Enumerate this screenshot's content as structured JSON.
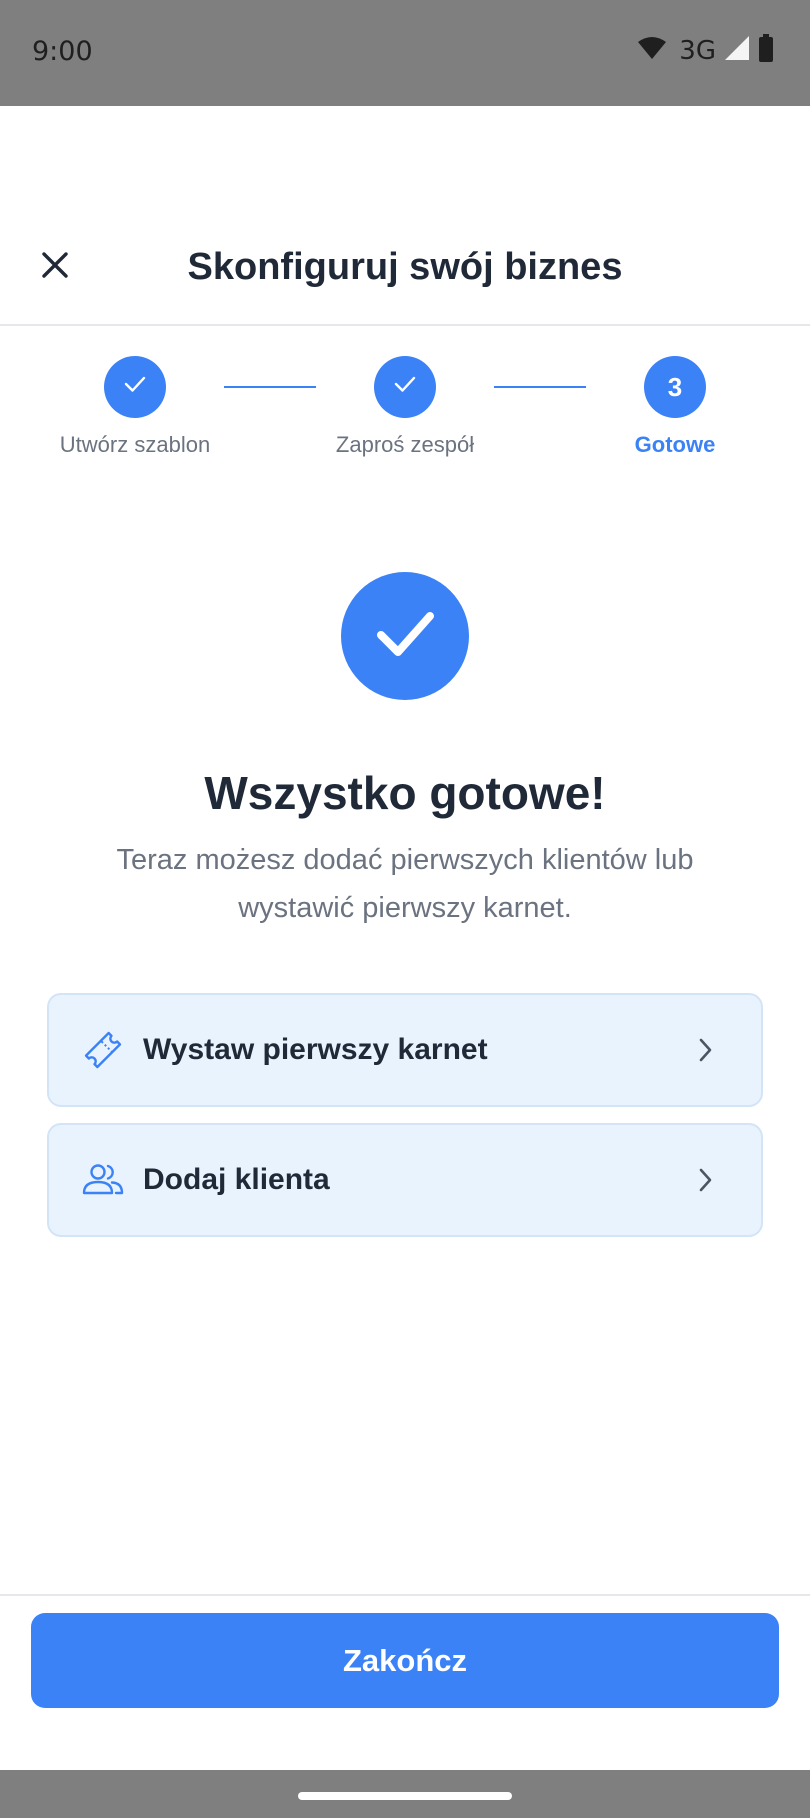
{
  "status_bar": {
    "time": "9:00",
    "network": "3G",
    "icons": [
      "wifi-icon",
      "cell-signal-icon",
      "battery-icon"
    ]
  },
  "header": {
    "title": "Skonfiguruj swój biznes",
    "close_icon": "close-icon"
  },
  "stepper": {
    "steps": [
      {
        "label": "Utwórz szablon",
        "state": "completed"
      },
      {
        "label": "Zaproś zespół",
        "state": "completed"
      },
      {
        "label": "Gotowe",
        "number": "3",
        "state": "active"
      }
    ]
  },
  "success": {
    "title": "Wszystko gotowe!",
    "message": "Teraz możesz dodać pierwszych klientów lub wystawić pierwszy karnet."
  },
  "actions": [
    {
      "label": "Wystaw pierwszy karnet",
      "icon": "ticket-icon"
    },
    {
      "label": "Dodaj klienta",
      "icon": "users-icon"
    }
  ],
  "footer": {
    "finish_label": "Zakończ"
  },
  "colors": {
    "accent": "#3b82f6",
    "card_bg": "#e9f3fd",
    "text_primary": "#1f2937",
    "text_secondary": "#6b7280"
  }
}
